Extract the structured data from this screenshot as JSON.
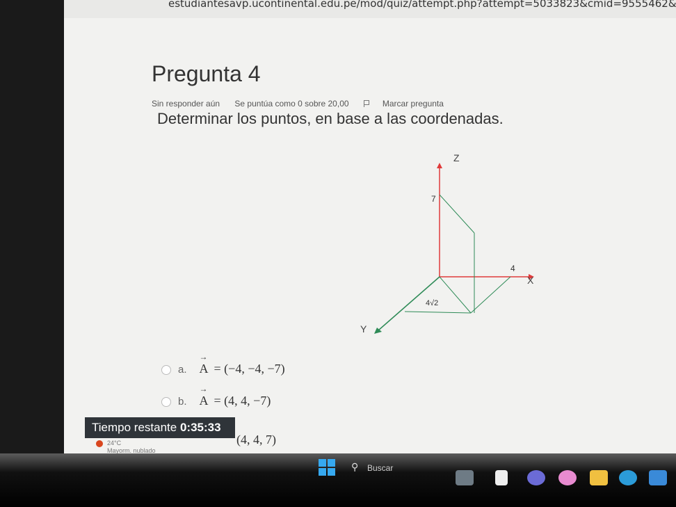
{
  "browser": {
    "url": "estudiantesavp.ucontinental.edu.pe/mod/quiz/attempt.php?attempt=5033823&cmid=9555462&page=3"
  },
  "question": {
    "title": "Pregunta 4",
    "status": "Sin responder aún",
    "score": "Se puntúa como 0 sobre 20,00",
    "flag_label": "Marcar pregunta",
    "text": "Determinar los puntos, en base a las coordenadas."
  },
  "diagram": {
    "z_label": "Z",
    "x_label": "X",
    "y_label": "Y",
    "z_value": "7",
    "x_value": "4",
    "y_value": "4√2",
    "colors": {
      "axis": "#e03a3a",
      "box": "#2e8b57"
    }
  },
  "answers": [
    {
      "letter": "a.",
      "vector": "A",
      "value": "= (−4, −4, −7)"
    },
    {
      "letter": "b.",
      "vector": "A",
      "value": "= (4, 4, −7)"
    },
    {
      "letter": "",
      "vector": "",
      "value": "(4, 4, 7)"
    }
  ],
  "timer": {
    "label": "Tiempo restante",
    "time": "0:35:33"
  },
  "weather": {
    "temp": "24°C",
    "desc": "Mayorm. nublado"
  },
  "taskbar": {
    "search_placeholder": "Buscar"
  }
}
